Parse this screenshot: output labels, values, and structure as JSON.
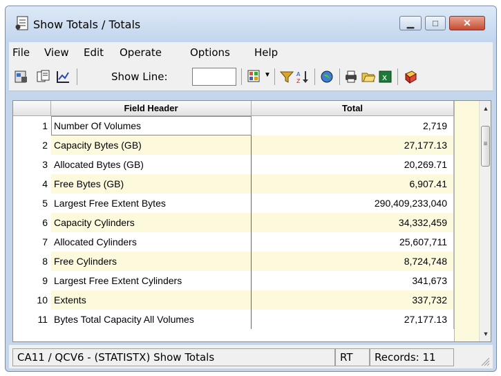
{
  "window": {
    "title": "Show Totals / Totals"
  },
  "menu": [
    "File",
    "View",
    "Edit",
    "Operate",
    "Options",
    "Help"
  ],
  "toolbar": {
    "show_line_label": "Show Line:",
    "show_line_value": ""
  },
  "grid": {
    "columns": [
      "Field Header",
      "Total"
    ],
    "rows": [
      {
        "num": "1",
        "field": "Number Of Volumes",
        "total": "2,719"
      },
      {
        "num": "2",
        "field": "Capacity Bytes (GB)",
        "total": "27,177.13"
      },
      {
        "num": "3",
        "field": "Allocated Bytes (GB)",
        "total": "20,269.71"
      },
      {
        "num": "4",
        "field": "Free Bytes (GB)",
        "total": "6,907.41"
      },
      {
        "num": "5",
        "field": "Largest Free Extent Bytes",
        "total": "290,409,233,040"
      },
      {
        "num": "6",
        "field": "Capacity Cylinders",
        "total": "34,332,459"
      },
      {
        "num": "7",
        "field": "Allocated Cylinders",
        "total": "25,607,711"
      },
      {
        "num": "8",
        "field": "Free Cylinders",
        "total": "8,724,748"
      },
      {
        "num": "9",
        "field": "Largest Free Extent Cylinders",
        "total": "341,673"
      },
      {
        "num": "10",
        "field": "Extents",
        "total": "337,732"
      },
      {
        "num": "11",
        "field": "Bytes Total Capacity All Volumes",
        "total": "27,177.13"
      }
    ]
  },
  "status": {
    "main": "CA11 / QCV6 - (STATISTX) Show Totals",
    "mode": "RT",
    "records": "Records: 11"
  },
  "colors": {
    "alt_row": "#fdf9dc",
    "title_bar": "#c4d6ec",
    "close_button": "#c74a32"
  }
}
